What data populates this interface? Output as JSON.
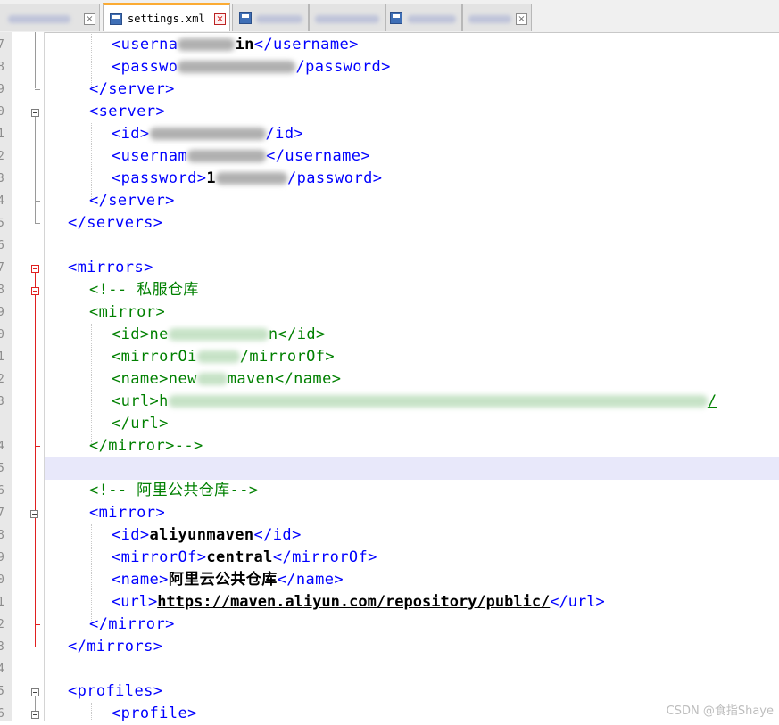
{
  "tabs": {
    "active_label": "settings.xml",
    "close_glyph": "×"
  },
  "line_numbers": [
    "7",
    "8",
    "9",
    "0",
    "1",
    "2",
    "3",
    "4",
    "5",
    "6",
    "7",
    "8",
    "9",
    "0",
    "1",
    "2",
    "3",
    "",
    "4",
    "5",
    "6",
    "7",
    "8",
    "9",
    "0",
    "1",
    "2",
    "3",
    "4",
    "5",
    "6"
  ],
  "code": {
    "l1_open": "<userna",
    "l1_vis": "in",
    "l1_close": "</username>",
    "l2_open": "<passwo",
    "l2_close": "/password>",
    "l3": "</server>",
    "l4": "<server>",
    "l5_open": "<id>",
    "l5_close": "/id>",
    "l6_open": "<usernam",
    "l6_close": "</username>",
    "l7_open": "<password>",
    "l7_vis": "1",
    "l7_close": "/password>",
    "l8": "</server>",
    "l9": "</servers>",
    "l10": "<mirrors>",
    "l11": "<!-- 私服仓库",
    "l12": "<mirror>",
    "l13_open": "<id>ne",
    "l13_close": "n</id>",
    "l14_open": "<mirrorOi",
    "l14_close": "/mirrorOf>",
    "l15_open": "<name>new",
    "l15_close": "maven</name>",
    "l16_open": "<url>h",
    "l16_close": "/",
    "l17": "</url>",
    "l18": "</mirror>-->",
    "l19": "<!-- 阿里公共仓库-->",
    "l20": "<mirror>",
    "l21_open": "<id>",
    "l21_val": "aliyunmaven",
    "l21_close": "</id>",
    "l22_open": "<mirrorOf>",
    "l22_val": "central",
    "l22_close": "</mirrorOf>",
    "l23_open": "<name>",
    "l23_val": "阿里云公共仓库",
    "l23_close": "</name>",
    "l24_open": "<url>",
    "l24_val": "https://maven.aliyun.com/repository/public/",
    "l24_close": "</url>",
    "l25": "</mirror>",
    "l26": "</mirrors>",
    "l27": "<profiles>",
    "l28": "<profile>"
  },
  "watermark": "CSDN @食指Shaye",
  "colors": {
    "tag": "#0000ff",
    "comment": "#008000",
    "text": "#000000",
    "current_line": "#e8e8fa",
    "fold_active": "#e02020",
    "tab_active_accent": "#fbab33"
  }
}
